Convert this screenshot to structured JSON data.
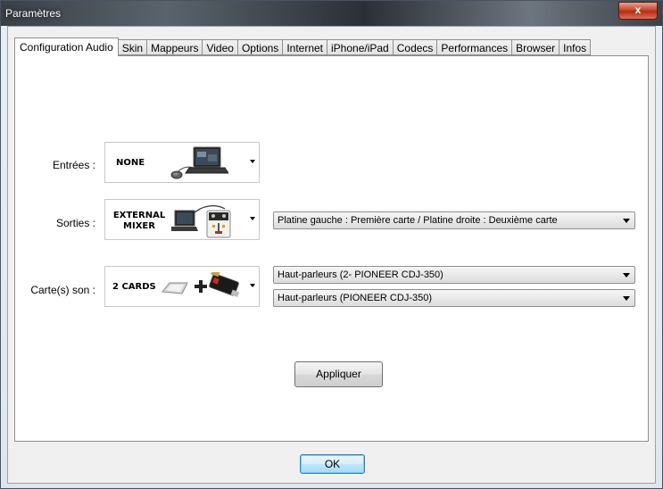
{
  "window": {
    "title": "Paramètres",
    "close_label": "x"
  },
  "tabs": [
    {
      "label": "Configuration Audio"
    },
    {
      "label": "Skin"
    },
    {
      "label": "Mappeurs"
    },
    {
      "label": "Video"
    },
    {
      "label": "Options"
    },
    {
      "label": "Internet"
    },
    {
      "label": "iPhone/iPad"
    },
    {
      "label": "Codecs"
    },
    {
      "label": "Performances"
    },
    {
      "label": "Browser"
    },
    {
      "label": "Infos"
    }
  ],
  "audio": {
    "inputs": {
      "label": "Entrées :",
      "device": "NONE",
      "icon": "laptop-with-mouse-icon"
    },
    "outputs": {
      "label": "Sorties :",
      "device_line1": "EXTERNAL",
      "device_line2": "MIXER",
      "icon": "laptop-with-mixer-icon",
      "routing_value": "Platine gauche : Première carte / Platine droite : Deuxième carte"
    },
    "sound_cards": {
      "label": "Carte(s) son :",
      "device": "2 CARDS",
      "icon": "two-sound-cards-icon",
      "card1_value": "Haut-parleurs (2- PIONEER CDJ-350)",
      "card2_value": "Haut-parleurs (PIONEER CDJ-350)"
    },
    "apply_label": "Appliquer"
  },
  "footer": {
    "ok_label": "OK"
  },
  "colors": {
    "default_button_border": "#3c7fb1",
    "close_button": "#c7452c"
  }
}
